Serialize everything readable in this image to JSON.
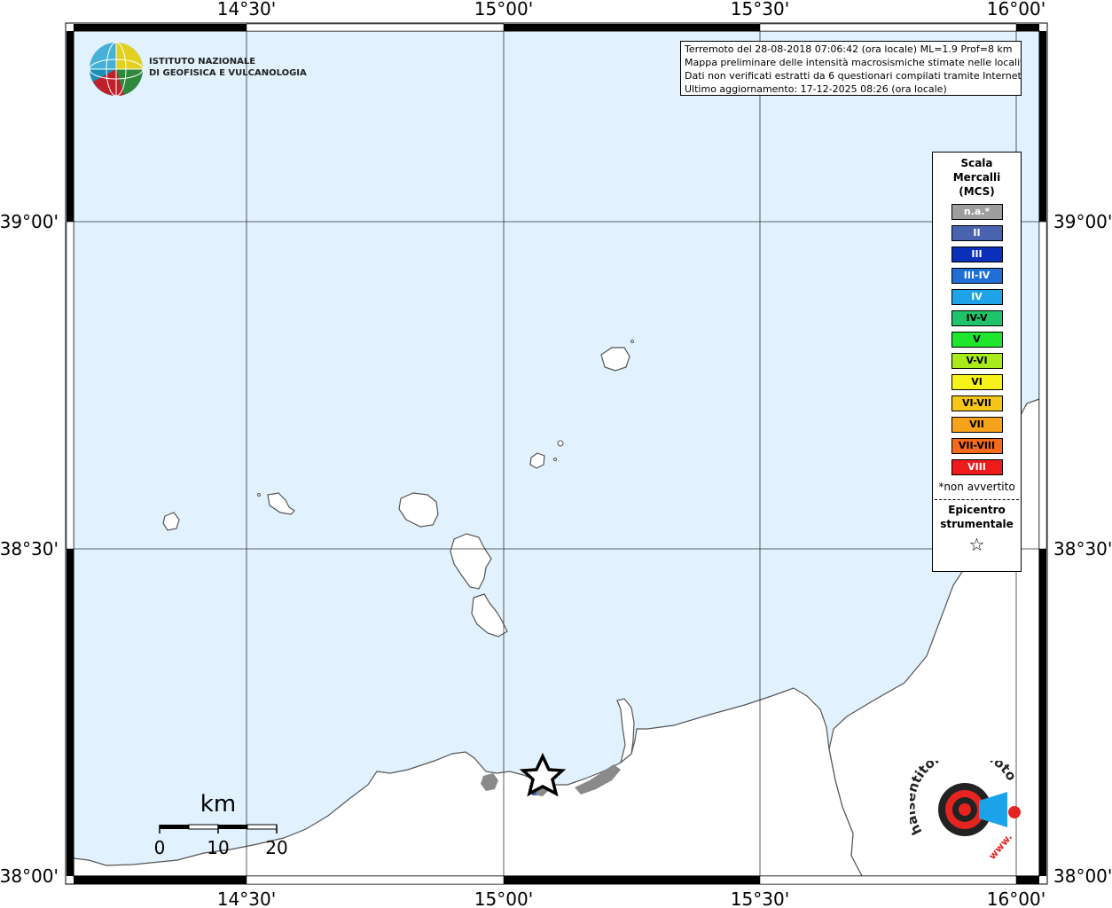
{
  "map": {
    "top_axis_labels": [
      "14°30'",
      "15°00'",
      "15°30'",
      "16°00'"
    ],
    "bottom_axis_labels": [
      "14°30'",
      "15°00'",
      "15°30'",
      "16°00'"
    ],
    "left_axis_labels": [
      "39°00'",
      "38°30'",
      "38°00'"
    ],
    "right_axis_labels": [
      "39°00'",
      "38°30'",
      "38°00'"
    ],
    "sea_color": "#e1f1fd",
    "land_color": "#ffffff"
  },
  "logo_ingv": {
    "line1": "ISTITUTO NAZIONALE",
    "line2": "DI GEOFISICA E VULCANOLOGIA"
  },
  "info": {
    "line1": "Terremoto del 28-08-2018 07:06:42 (ora locale) ML=1.9 Prof=8 km",
    "line2": "Mappa preliminare delle intensità macrosismiche stimate nelle località",
    "line3": "Dati non verificati estratti da 6 questionari compilati tramite Internet.",
    "line4": "Ultimo aggiornamento: 17-12-2025 08:26 (ora locale)"
  },
  "legend": {
    "title_line1": "Scala",
    "title_line2": "Mercalli",
    "title_line3": "(MCS)",
    "items": [
      {
        "label": "n.a.*",
        "color": "#9e9e9e",
        "text_color": "#ffffff"
      },
      {
        "label": "II",
        "color": "#4a63b0",
        "text_color": "#ffffff"
      },
      {
        "label": "III",
        "color": "#0a2fb8",
        "text_color": "#ffffff"
      },
      {
        "label": "III-IV",
        "color": "#1f6fd6",
        "text_color": "#ffffff"
      },
      {
        "label": "IV",
        "color": "#1ca3e8",
        "text_color": "#ffffff"
      },
      {
        "label": "IV-V",
        "color": "#1fc46a",
        "text_color": "#000000"
      },
      {
        "label": "V",
        "color": "#1ee62d",
        "text_color": "#000000"
      },
      {
        "label": "V-VI",
        "color": "#a8ea1a",
        "text_color": "#000000"
      },
      {
        "label": "VI",
        "color": "#f7f21a",
        "text_color": "#000000"
      },
      {
        "label": "VI-VII",
        "color": "#f5c518",
        "text_color": "#000000"
      },
      {
        "label": "VII",
        "color": "#f7a21b",
        "text_color": "#000000"
      },
      {
        "label": "VII-VIII",
        "color": "#f56a1a",
        "text_color": "#000000"
      },
      {
        "label": "VIII",
        "color": "#ef1a1a",
        "text_color": "#ffffff"
      }
    ],
    "note": "*non avvertito",
    "epicenter_line1": "Epicentro",
    "epicenter_line2": "strumentale"
  },
  "scale_bar": {
    "unit": "km",
    "labels": [
      "0",
      "10",
      "20"
    ]
  },
  "hst_logo": {
    "text": "haisentitoilterremoto.it",
    "prefix": "www."
  }
}
